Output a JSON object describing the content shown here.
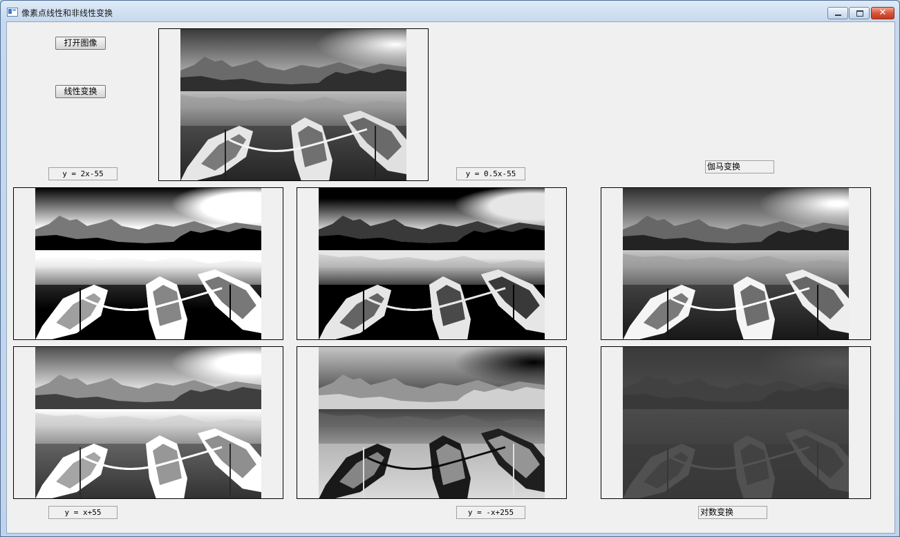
{
  "window": {
    "title": "像素点线性和非线性变换",
    "close_glyph": "✕"
  },
  "buttons": {
    "open_image": "打开图像",
    "linear_transform": "线性变换"
  },
  "labels": {
    "y_2x_55": "y = 2x-55",
    "y_05x_55": "y = 0.5x-55",
    "gamma": "伽马变换",
    "y_x_55": "y = x+55",
    "y_neg_x_255": "y = -x+255",
    "log": "对数变换"
  },
  "images": {
    "original": "grayscale",
    "y_2x_55": "brightened-high-contrast",
    "y_05x_55": "darkened-clipped",
    "gamma": "gamma-corrected",
    "y_x_55": "brightened",
    "y_neg_x_255": "inverted",
    "log": "log-dark"
  }
}
